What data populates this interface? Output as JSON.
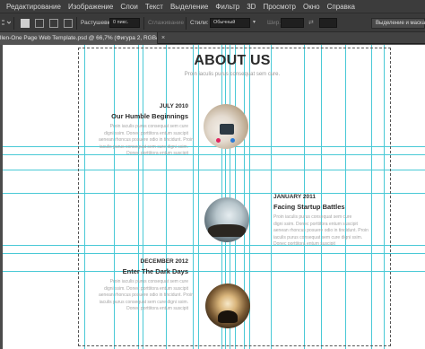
{
  "menu": [
    "Редактирование",
    "Изображение",
    "Слои",
    "Текст",
    "Выделение",
    "Фильтр",
    "3D",
    "Просмотр",
    "Окно",
    "Справка"
  ],
  "options": {
    "feather_label": "Растушевка:",
    "feather_value": "0 пикс.",
    "antialias_label": "Сглаживание",
    "style_label": "Стили:",
    "style_value": "Обычный",
    "width_label": "Шир.:",
    "select_mask_button": "Выделение и маска..."
  },
  "document": {
    "tab_title": "llen-One Page Web Template.psd @ 66,7% (Фигура 2, RGB/8*)",
    "close_glyph": "×"
  },
  "about": {
    "title": "ABOUT US",
    "subtitle": "Proin iaculis purus consequat sem cure."
  },
  "timeline": [
    {
      "date": "JULY 2010",
      "heading": "Our Humble Beginnings",
      "body": [
        "Proin iaculis purus consequat sem cure",
        "digni ssim. Donec porttitora entum suscipit",
        "aenean rhoncus posuere odio in tincidunt. Proin",
        "iaculis purus consequat sem cure digni ssim.",
        "Donec porttitora entum suscipit"
      ]
    },
    {
      "date": "JANUARY 2011",
      "heading": "Facing Startup Battles",
      "body": [
        "Proin iaculis purus consequat sem cure",
        "digni ssim. Donec porttitora entum suscipit",
        "aenean rhoncus posuere odio in tincidunt. Proin",
        "iaculis purus consequat sem cure digni ssim.",
        "Donec porttitora entum suscipit"
      ]
    },
    {
      "date": "DECEMBER 2012",
      "heading": "Enter The Dark Days",
      "body": [
        "Proin iaculis purus consequat sem cure",
        "digni ssim. Donec porttitora entum suscipit",
        "aenean rhoncus posuere odio in tincidunt. Proin",
        "iaculis purus consequat sem cure digni ssim.",
        "Donec porttitora entum suscipit"
      ]
    }
  ],
  "colors": {
    "guide": "#49c9d6",
    "menubar_bg": "#3c3c3c",
    "canvas_bg": "#ffffff"
  }
}
